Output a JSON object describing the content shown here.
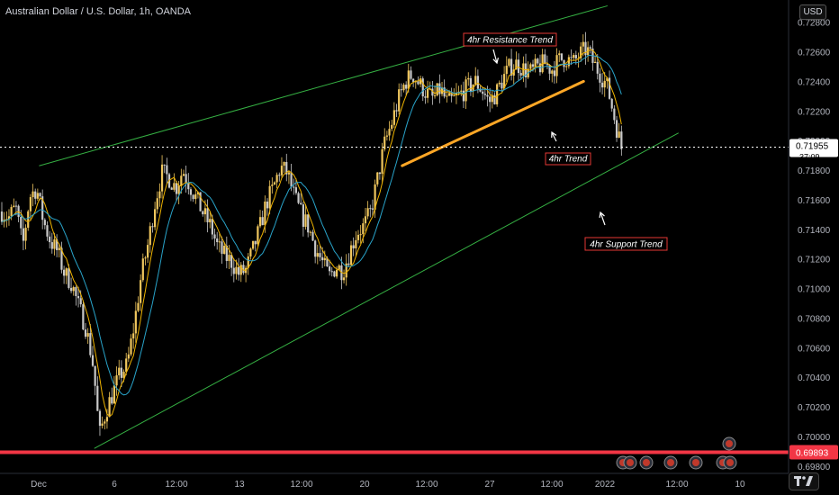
{
  "header": {
    "title": "Australian Dollar / U.S. Dollar, 1h, OANDA"
  },
  "currency_button": "USD",
  "colors": {
    "background": "#000000",
    "candle": "#f0c75e",
    "candle_down": "#c9c9c9",
    "ma_fast": "#f0b400",
    "ma_slow": "#29a3c9",
    "channel": "#35b043",
    "trend_orange": "#ffa726",
    "support_line": "#f23645",
    "price_label_bg": "#ffffff"
  },
  "chart_data": {
    "type": "candlestick",
    "symbol": "AUDUSD",
    "interval": "1h",
    "y_axis": {
      "range": [
        0.6975,
        0.7295
      ],
      "ticks": [
        "0.72800",
        "0.72600",
        "0.72400",
        "0.72200",
        "0.72000",
        "0.71800",
        "0.71600",
        "0.71400",
        "0.71200",
        "0.71000",
        "0.70800",
        "0.70600",
        "0.70400",
        "0.70200",
        "0.70000",
        "0.69800"
      ]
    },
    "x_axis": {
      "labels": [
        "Dec",
        "6",
        "12:00",
        "13",
        "12:00",
        "20",
        "12:00",
        "27",
        "12:00",
        "2022",
        "12:00",
        "10"
      ]
    },
    "current_price": {
      "value": "0.71955",
      "countdown": "37:09"
    },
    "level_line": {
      "value": "0.69893"
    },
    "price_path": [
      [
        0,
        0.7152
      ],
      [
        2,
        0.7148
      ],
      [
        4,
        0.7155
      ],
      [
        6,
        0.7128
      ],
      [
        8,
        0.7162
      ],
      [
        10,
        0.7168
      ],
      [
        12,
        0.7145
      ],
      [
        14,
        0.7132
      ],
      [
        16,
        0.7125
      ],
      [
        18,
        0.711
      ],
      [
        20,
        0.7104
      ],
      [
        22,
        0.7088
      ],
      [
        24,
        0.7075
      ],
      [
        26,
        0.7052
      ],
      [
        27,
        0.703
      ],
      [
        28,
        0.7
      ],
      [
        30,
        0.7018
      ],
      [
        32,
        0.703
      ],
      [
        34,
        0.7042
      ],
      [
        36,
        0.7048
      ],
      [
        38,
        0.7075
      ],
      [
        40,
        0.7108
      ],
      [
        42,
        0.713
      ],
      [
        44,
        0.7158
      ],
      [
        46,
        0.7178
      ],
      [
        48,
        0.7175
      ],
      [
        50,
        0.7168
      ],
      [
        52,
        0.718
      ],
      [
        54,
        0.717
      ],
      [
        56,
        0.716
      ],
      [
        58,
        0.715
      ],
      [
        60,
        0.7142
      ],
      [
        62,
        0.7128
      ],
      [
        64,
        0.7122
      ],
      [
        66,
        0.7118
      ],
      [
        68,
        0.711
      ],
      [
        70,
        0.7112
      ],
      [
        72,
        0.7125
      ],
      [
        74,
        0.714
      ],
      [
        76,
        0.7158
      ],
      [
        78,
        0.7168
      ],
      [
        80,
        0.7182
      ],
      [
        82,
        0.7178
      ],
      [
        84,
        0.7162
      ],
      [
        86,
        0.715
      ],
      [
        88,
        0.7142
      ],
      [
        90,
        0.7128
      ],
      [
        92,
        0.7118
      ],
      [
        94,
        0.7108
      ],
      [
        96,
        0.7115
      ],
      [
        98,
        0.7112
      ],
      [
        100,
        0.7125
      ],
      [
        102,
        0.7138
      ],
      [
        104,
        0.7142
      ],
      [
        106,
        0.7152
      ],
      [
        108,
        0.7175
      ],
      [
        110,
        0.7198
      ],
      [
        112,
        0.7212
      ],
      [
        114,
        0.7228
      ],
      [
        116,
        0.724
      ],
      [
        118,
        0.7245
      ],
      [
        120,
        0.7238
      ],
      [
        122,
        0.7232
      ],
      [
        124,
        0.7228
      ],
      [
        126,
        0.7235
      ],
      [
        128,
        0.7225
      ],
      [
        130,
        0.7228
      ],
      [
        132,
        0.7232
      ],
      [
        134,
        0.7236
      ],
      [
        136,
        0.724
      ],
      [
        138,
        0.7234
      ],
      [
        140,
        0.7226
      ],
      [
        142,
        0.7232
      ],
      [
        144,
        0.7242
      ],
      [
        146,
        0.725
      ],
      [
        148,
        0.7252
      ],
      [
        150,
        0.7248
      ],
      [
        152,
        0.7246
      ],
      [
        154,
        0.725
      ],
      [
        156,
        0.7252
      ],
      [
        158,
        0.7248
      ],
      [
        160,
        0.7254
      ],
      [
        162,
        0.7256
      ],
      [
        164,
        0.7252
      ],
      [
        166,
        0.7258
      ],
      [
        168,
        0.7262
      ],
      [
        170,
        0.7252
      ],
      [
        172,
        0.7245
      ],
      [
        174,
        0.7236
      ],
      [
        176,
        0.7215
      ],
      [
        177,
        0.7205
      ],
      [
        178,
        0.7195
      ]
    ],
    "drawings": [
      {
        "kind": "channel_upper",
        "label": "",
        "from": [
          0.05,
          0.7183
        ],
        "to": [
          0.77,
          0.7291
        ]
      },
      {
        "kind": "channel_lower",
        "label": "",
        "from": [
          0.12,
          0.6992
        ],
        "to": [
          0.86,
          0.7205
        ]
      },
      {
        "kind": "trend",
        "label": "",
        "from": [
          0.51,
          0.7183
        ],
        "to": [
          0.74,
          0.724
        ]
      }
    ],
    "annotations": [
      {
        "text": "4hr Resistance Trend"
      },
      {
        "text": "4hr Trend"
      },
      {
        "text": "4hr Support Trend"
      }
    ]
  }
}
